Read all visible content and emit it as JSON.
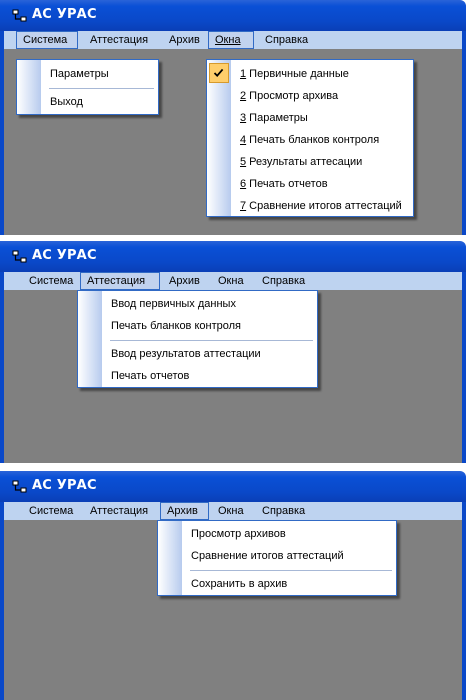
{
  "app": {
    "title": "АС УРАС"
  },
  "panels": [
    {
      "menubar": [
        "Система",
        "Аттестация",
        "Архив",
        "Окна",
        "Справка"
      ],
      "open_index": 0,
      "dropdowns": [
        {
          "menu": "Система",
          "items": [
            "Параметры",
            "Выход"
          ]
        },
        {
          "menu": "Окна",
          "items": [
            {
              "num": "1",
              "label": " Первичные данные",
              "checked": true
            },
            {
              "num": "2",
              "label": " Просмотр архива",
              "checked": false
            },
            {
              "num": "3",
              "label": " Параметры",
              "checked": false
            },
            {
              "num": "4",
              "label": " Печать бланков контроля",
              "checked": false
            },
            {
              "num": "5",
              "label": " Результаты аттесации",
              "checked": false
            },
            {
              "num": "6",
              "label": " Печать отчетов",
              "checked": false
            },
            {
              "num": "7",
              "label": " Сравнение итогов аттестаций",
              "checked": false
            }
          ]
        }
      ]
    },
    {
      "menubar": [
        "Система",
        "Аттестация",
        "Архив",
        "Окна",
        "Справка"
      ],
      "open_index": 1,
      "dropdown": {
        "items": [
          "Ввод первичных данных",
          "Печать бланков контроля",
          "Ввод результатов аттестации",
          "Печать отчетов"
        ]
      }
    },
    {
      "menubar": [
        "Система",
        "Аттестация",
        "Архив",
        "Окна",
        "Справка"
      ],
      "open_index": 2,
      "dropdown": {
        "items": [
          "Просмотр архивов",
          "Сравнение итогов аттестаций",
          "Сохранить в архив"
        ]
      }
    }
  ],
  "colors": {
    "titlebar": "#0a48c8",
    "menubar": "#bed3f0",
    "client": "#808080",
    "highlight_border": "#316ac5",
    "check": "#ffce6b"
  },
  "icons": {
    "title": "app-icon",
    "check": "checkmark-icon"
  }
}
